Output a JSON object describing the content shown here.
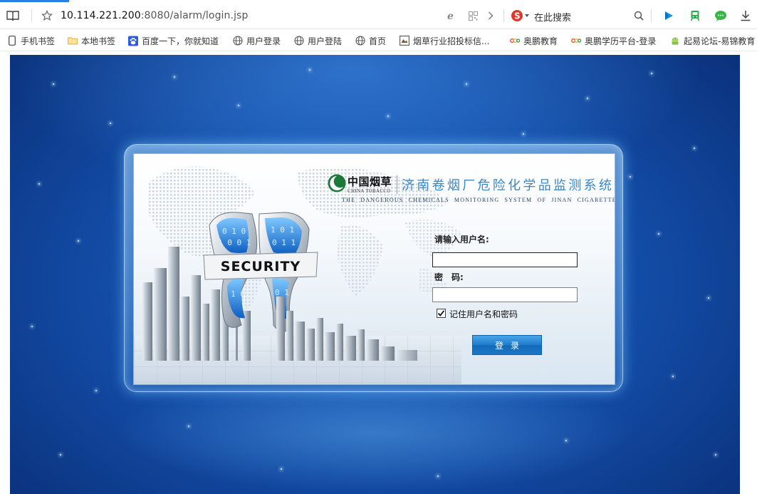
{
  "browser": {
    "url_host": "10.114.221.200",
    "url_path": ":8080/alarm/login.jsp",
    "search_label": "在此搜索",
    "bookmarks": [
      {
        "label": "手机书签",
        "icon": "phone-icon"
      },
      {
        "label": "本地书签",
        "icon": "folder-icon"
      },
      {
        "label": "百度一下，你就知道",
        "icon": "baidu-paw-icon"
      },
      {
        "label": "用户登录",
        "icon": "globe-icon"
      },
      {
        "label": "用户登陆",
        "icon": "globe-icon"
      },
      {
        "label": "首页",
        "icon": "globe-icon"
      },
      {
        "label": "烟草行业招投标信...",
        "icon": "page-icon"
      },
      {
        "label": "奥鹏教育",
        "icon": "aopeng-icon"
      },
      {
        "label": "奥鹏学历平台-登录",
        "icon": "aopeng-icon"
      },
      {
        "label": "起易论坛-易锦教育",
        "icon": "android-icon"
      }
    ]
  },
  "login": {
    "brand_cn": "中国烟草",
    "brand_en": "CHINA TOBACCO",
    "title_cn": "济南卷烟厂危险化学品监测系统",
    "title_en": "THE DANGEROUS CHEMICALS MONITORING SYSTEM OF JINAN CIGARETTE FACTORY",
    "shield_text": "SECURITY",
    "username_label": "请输入用户名:",
    "username_value": "",
    "password_label": "密　码:",
    "password_value": "",
    "remember_label": "记住用户名和密码",
    "remember_checked": true,
    "login_button": "登录"
  },
  "colors": {
    "title": "#3c86c4",
    "button": "#1e7ccd",
    "page_bg": "#124aa3"
  }
}
